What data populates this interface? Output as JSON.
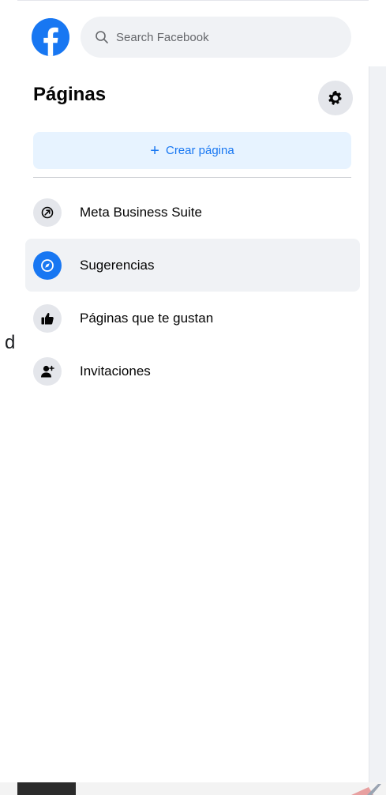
{
  "header": {
    "search_placeholder": "Search Facebook"
  },
  "left_cut": {
    "letter": "d"
  },
  "sidebar": {
    "title": "Páginas",
    "create_label": "Crear página",
    "create_plus": "+",
    "items": [
      {
        "label": "Meta Business Suite",
        "icon": "meta-business-suite-icon",
        "active": false
      },
      {
        "label": "Sugerencias",
        "icon": "compass-icon",
        "active": true
      },
      {
        "label": "Páginas que te gustan",
        "icon": "thumbs-up-icon",
        "active": false
      },
      {
        "label": "Invitaciones",
        "icon": "person-add-icon",
        "active": false
      }
    ]
  },
  "colors": {
    "brand_blue": "#1877f2",
    "active_bg": "#f0f2f5",
    "create_bg": "#e7f3ff"
  }
}
